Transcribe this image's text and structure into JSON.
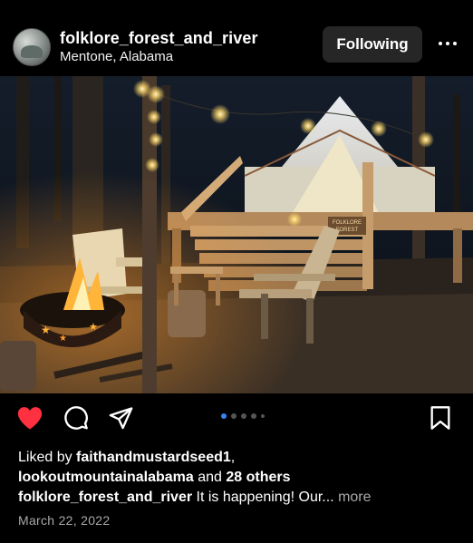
{
  "post": {
    "username": "folklore_forest_and_river",
    "location": "Mentone, Alabama",
    "follow_label": "Following",
    "more_icon": "more-horizontal-icon"
  },
  "photo": {
    "sign_text": "FOLKLORE\nFOREST"
  },
  "actions": {
    "like_icon": "heart-filled-icon",
    "like_color": "#ff3040",
    "comment_icon": "comment-icon",
    "share_icon": "send-icon",
    "save_icon": "bookmark-icon",
    "carousel": {
      "count": 5,
      "active_index": 0,
      "accent": "#3b82f6"
    }
  },
  "likes": {
    "prefix": "Liked by ",
    "user1": "faithandmustardseed1",
    "separator": ",",
    "user2": "lookoutmountainalabama",
    "middle": " and ",
    "others": "28 others"
  },
  "caption": {
    "username": "folklore_forest_and_river",
    "text": " It is happening! Our...",
    "more": " more"
  },
  "date": "March 22, 2022"
}
